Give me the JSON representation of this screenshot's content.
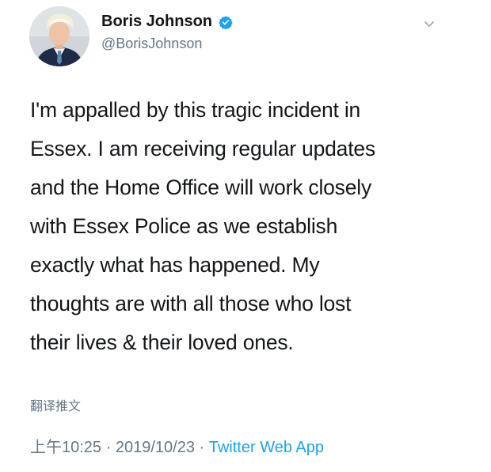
{
  "user": {
    "display_name": "Boris Johnson",
    "handle": "@BorisJohnson",
    "verified": true,
    "avatar_icon": "profile-photo"
  },
  "tweet": {
    "lines": [
      "I'm appalled by this tragic incident in",
      "Essex. I am receiving regular updates",
      "and the Home Office will work closely",
      "with Essex Police as we establish",
      "exactly what has happened. My",
      "thoughts are with all those who lost",
      "their lives & their loved ones."
    ]
  },
  "translate_label": "翻译推文",
  "meta": {
    "time": "上午10:25",
    "sep1": " · ",
    "date": "2019/10/23",
    "sep2": " · ",
    "source": "Twitter Web App"
  },
  "colors": {
    "text": "#14171a",
    "secondary": "#657786",
    "accent": "#1da1f2"
  },
  "icons": {
    "verified": "verified-badge-icon",
    "menu": "chevron-down-icon"
  }
}
